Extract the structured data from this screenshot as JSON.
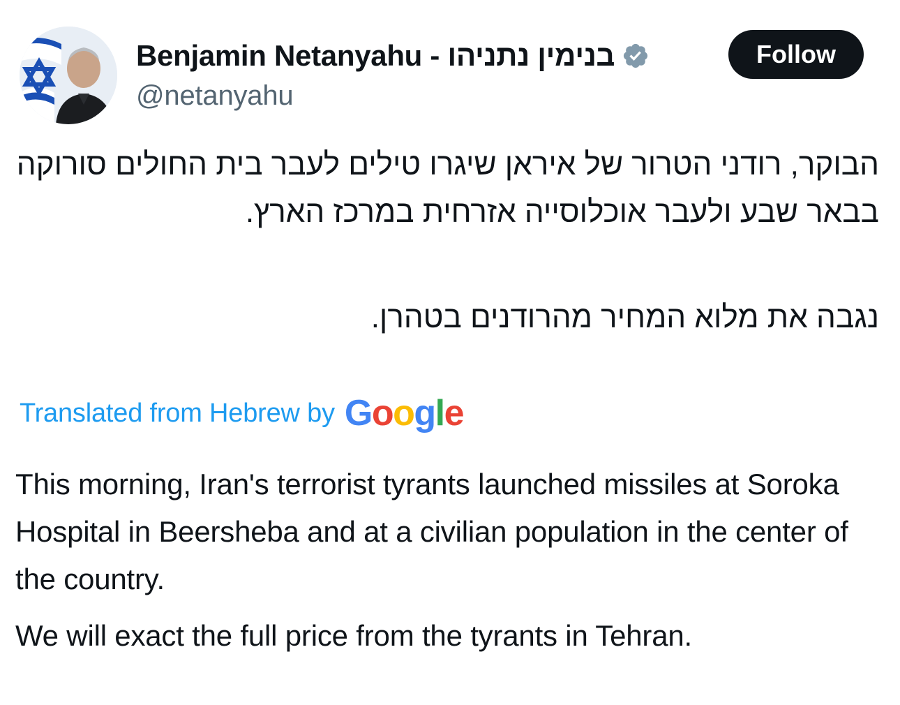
{
  "author": {
    "display_name": "Benjamin Netanyahu - בנימין נתניהו",
    "handle": "@netanyahu",
    "verified_icon": "verified-badge-icon"
  },
  "follow_button": {
    "label": "Follow"
  },
  "tweet": {
    "hebrew_paragraph_1": "הבוקר, רודני הטרור של איראן שיגרו טילים לעבר בית החולים סורוקה בבאר שבע ולעבר אוכלוסייה אזרחית במרכז הארץ.",
    "hebrew_paragraph_2": "נגבה את מלוא המחיר מהרודנים בטהרן.",
    "translation_label": "Translated from Hebrew by",
    "translation_provider": "Google",
    "english_paragraph_1": "This morning, Iran's terrorist tyrants launched missiles at Soroka Hospital in Beersheba and at a civilian population in the center of the country.",
    "english_paragraph_2": "We will exact the full price from the tyrants in Tehran."
  },
  "colors": {
    "link_blue": "#1d9bf0",
    "handle_gray": "#536471",
    "follow_bg": "#0f1419",
    "verified_gray": "#829aab"
  }
}
